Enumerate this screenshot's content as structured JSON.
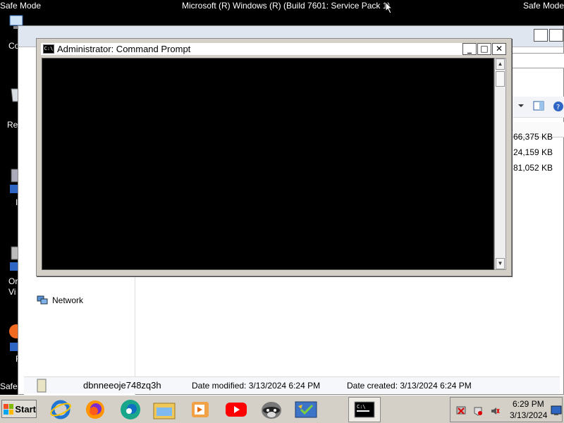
{
  "screen": {
    "safe_mode_label": "Safe Mode",
    "system_title": "Microsoft (R) Windows (R) (Build 7601: Service Pack 1)"
  },
  "desktop": {
    "partial_labels": [
      "Co",
      "Rec",
      "I",
      "Or",
      "Vi",
      "F"
    ]
  },
  "explorer": {
    "file_sizes": [
      "66,375 KB",
      "24,159 KB",
      "81,052 KB"
    ],
    "column_header_partial": "e",
    "nav": {
      "network_label": "Network"
    },
    "details": {
      "file_name": "dbnneeoje748zq3h",
      "date_modified": "Date modified: 3/13/2024 6:24 PM",
      "date_created": "Date created: 3/13/2024 6:24 PM"
    }
  },
  "cmd": {
    "title": "Administrator:  Command Prompt",
    "icon_text": "C:\\",
    "buttons": {
      "minimize": "_",
      "maximize": "□",
      "close": "✕"
    }
  },
  "taskbar": {
    "start_label": "Start",
    "apps": [
      "internet-explorer",
      "firefox",
      "edge",
      "file-explorer",
      "media-player",
      "youtube",
      "raccoon-app",
      "task-app",
      "command-prompt"
    ],
    "clock": {
      "time": "6:29 PM",
      "date": "3/13/2024"
    }
  },
  "colors": {
    "desktop": "#000000",
    "taskbar": "#d4d0c8",
    "console": "#000000"
  }
}
